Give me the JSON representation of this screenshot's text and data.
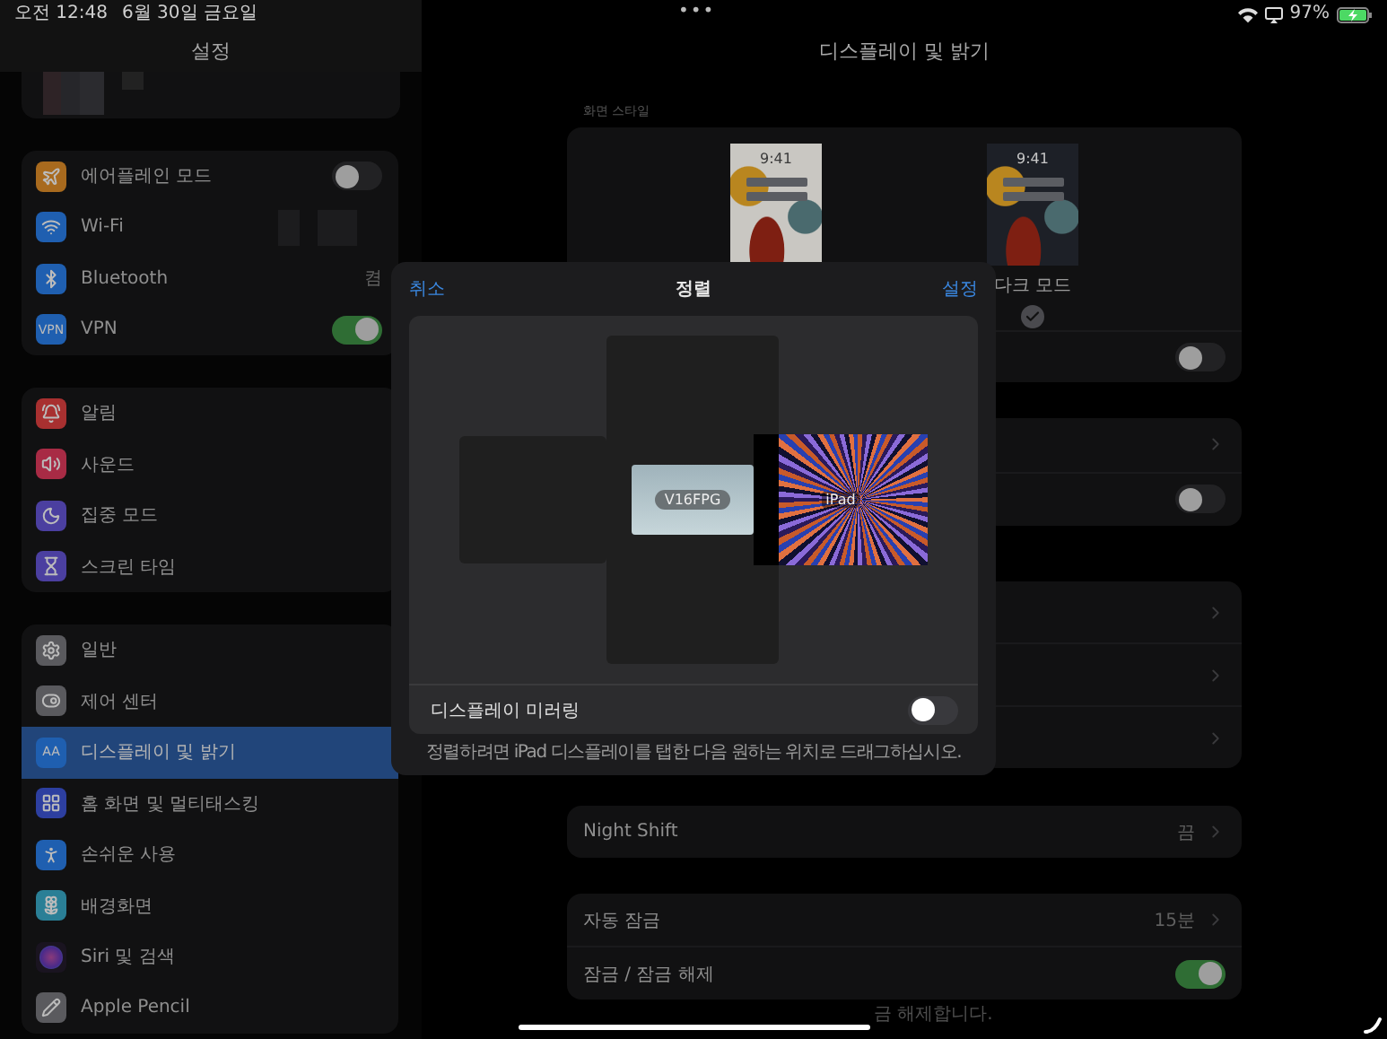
{
  "status_bar": {
    "time": "오전 12:48",
    "date": "6월 30일 금요일",
    "dots": "•••",
    "battery": "97%"
  },
  "sidebar": {
    "title": "설정",
    "groups": [
      {
        "items": [
          {
            "label": "에어플레인 모드",
            "color": "#a86a1e",
            "kind": "toggle",
            "on": false,
            "selected": false
          },
          {
            "label": "Wi-Fi",
            "color": "#1f5fb0",
            "kind": "redacted",
            "selected": false
          },
          {
            "label": "Bluetooth",
            "color": "#1f5fb0",
            "kind": "value",
            "value": "켬",
            "selected": false
          },
          {
            "label": "VPN",
            "icon_text": "VPN",
            "color": "#1f5fb0",
            "kind": "toggle",
            "on": true,
            "selected": false
          }
        ]
      },
      {
        "items": [
          {
            "label": "알림",
            "color": "#a83030",
            "kind": "plain",
            "selected": false
          },
          {
            "label": "사운드",
            "color": "#a82b45",
            "kind": "plain",
            "selected": false
          },
          {
            "label": "집중 모드",
            "color": "#4b3fa0",
            "kind": "plain",
            "selected": false
          },
          {
            "label": "스크린 타임",
            "color": "#4b3fa0",
            "kind": "plain",
            "selected": false
          }
        ]
      },
      {
        "items": [
          {
            "label": "일반",
            "color": "#5a5a5e",
            "kind": "plain",
            "selected": false
          },
          {
            "label": "제어 센터",
            "color": "#5a5a5e",
            "kind": "plain",
            "selected": false
          },
          {
            "label": "디스플레이 및 밝기",
            "icon_text": "AA",
            "color": "#1f5fb0",
            "kind": "plain",
            "selected": true
          },
          {
            "label": "홈 화면 및 멀티태스킹",
            "color": "#2d3fa0",
            "kind": "plain",
            "selected": false
          },
          {
            "label": "손쉬운 사용",
            "color": "#1f5fb0",
            "kind": "plain",
            "selected": false
          },
          {
            "label": "배경화면",
            "color": "#2a7f96",
            "kind": "plain",
            "selected": false
          },
          {
            "label": "Siri 및 검색",
            "color": "#1a1420",
            "kind": "plain",
            "selected": false
          },
          {
            "label": "Apple Pencil",
            "color": "#5a5a5e",
            "kind": "plain",
            "selected": false
          }
        ]
      }
    ]
  },
  "detail": {
    "title": "디스플레이 및 밝기",
    "appearance": {
      "label": "화면 스타일",
      "options": [
        {
          "kind": "light",
          "time": "9:41"
        },
        {
          "kind": "dark",
          "time": "9:41",
          "label": "다크 모드",
          "selected": true
        }
      ],
      "rows": [
        {
          "kind": "toggle",
          "on": false
        }
      ]
    },
    "groups": [
      {
        "rows": [
          {
            "kind": "chevron"
          },
          {
            "kind": "toggle",
            "on": false
          }
        ]
      },
      {
        "rows": [
          {
            "kind": "chevron"
          },
          {
            "kind": "chevron"
          },
          {
            "kind": "chevron"
          }
        ]
      },
      {
        "rows": [
          {
            "kind": "chevron",
            "label": "Night Shift",
            "value": "끔"
          }
        ]
      },
      {
        "rows": [
          {
            "kind": "chevron",
            "label": "자동 잠금",
            "value": "15분"
          },
          {
            "kind": "toggle",
            "label": "잠금 / 잠금 해제",
            "on": true
          }
        ]
      }
    ],
    "footer": "금 해제합니다."
  },
  "dialog": {
    "cancel": "취소",
    "title": "정렬",
    "done": "설정",
    "displays": [
      {
        "kind": "external",
        "label": "V16FPG"
      },
      {
        "kind": "ipad",
        "label": "iPad"
      }
    ],
    "mirroring": {
      "label": "디스플레이 미러링",
      "on": false
    },
    "hint": "정렬하려면 iPad 디스플레이를 탭한 다음 원하는 위치로 드래그하십시오."
  }
}
